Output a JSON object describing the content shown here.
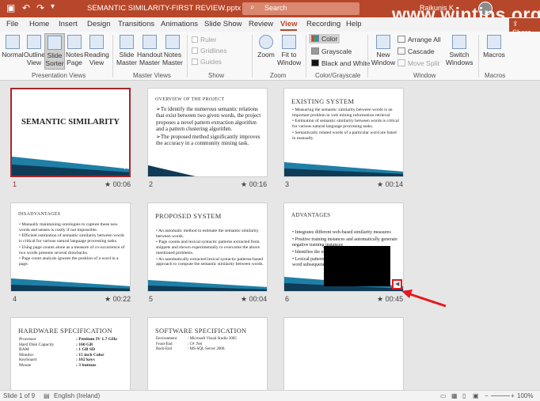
{
  "titlebar": {
    "title": "SEMANTIC SIMILARITY-FIRST REVIEW.pptx - PowerPoint",
    "search_placeholder": "Search",
    "user": "Raikunis K",
    "save_icon": "save-icon",
    "undo_icon": "undo-icon",
    "redo_icon": "redo-icon",
    "watermark": "www.wintips.org"
  },
  "tabs": [
    "File",
    "Home",
    "Insert",
    "Design",
    "Transitions",
    "Animations",
    "Slide Show",
    "Review",
    "View",
    "Recording",
    "Help"
  ],
  "active_tab": "View",
  "share_label": "Share",
  "ribbon": {
    "presentation_views": {
      "label": "Presentation Views",
      "buttons": [
        "Normal",
        "Outline View",
        "Slide Sorter",
        "Notes Page",
        "Reading View"
      ]
    },
    "master_views": {
      "label": "Master Views",
      "buttons": [
        "Slide Master",
        "Handout Master",
        "Notes Master"
      ]
    },
    "show": {
      "label": "Show",
      "items": [
        "Ruler",
        "Gridlines",
        "Guides"
      ]
    },
    "zoom": {
      "label": "Zoom",
      "buttons": [
        "Zoom",
        "Fit to Window"
      ]
    },
    "color": {
      "label": "Color/Grayscale",
      "items": [
        "Color",
        "Grayscale",
        "Black and White"
      ]
    },
    "window": {
      "label": "Window",
      "buttons": [
        "New Window"
      ],
      "items": [
        "Arrange All",
        "Cascade",
        "Move Split"
      ],
      "switch": "Switch Windows"
    },
    "macros": {
      "label": "Macros",
      "buttons": [
        "Macros"
      ]
    }
  },
  "slides": [
    {
      "num": "1",
      "time": "00:06",
      "title": "SEMANTIC SIMILARITY",
      "body": []
    },
    {
      "num": "2",
      "time": "00:16",
      "title": "OVERVIEW OF THE PROJECT",
      "body": [
        "➢To identify the numerous semantic relations that exist between two given words, the project proposes a novel pattern extraction algorithm and a pattern clustering algorithm.",
        "➢The proposed method significantly improves the accuracy in a community mining task."
      ]
    },
    {
      "num": "3",
      "time": "00:14",
      "title": "EXISTING SYSTEM",
      "body": [
        "• Measuring the semantic similarity between words is an important problem in web mining information retrieval",
        "• Estimation of semantic similarity between words is critical for various natural language processing tasks.",
        "• Semantically related words of a particular word are listed in manually"
      ]
    },
    {
      "num": "4",
      "time": "00:22",
      "title": "DISADVANTAGES",
      "body": [
        "• Manually maintaining ontologies to capture these new words and senses is costly if not impossible.",
        "• Efficient estimation of semantic similarity between words is critical for various natural language processing tasks.",
        "• Using page counts alone as a measure of co-occurrence of two words presents several drawbacks.",
        "• Page count analysis ignores the position of a word in a page."
      ]
    },
    {
      "num": "5",
      "time": "00:04",
      "title": "PROPOSED SYSTEM",
      "body": [
        "• An automatic method to estimate the semantic similarity between words.",
        "• Page counts and lexical syntactic patterns extracted from snippets and shown experimentally to overcome the above mentioned problems.",
        "• An automatically extracted lexical syntactic patterns-based approach to compute the semantic similarity between words."
      ]
    },
    {
      "num": "6",
      "time": "00:45",
      "title": "ADVANTAGES",
      "body": [
        "• Integrates different web-based similarity measures",
        "• Positive training instances and automatically generate negative training instances",
        "• Identifies the numerous semantic relations",
        "• Lexical patterns in a community mining considers word subsequences"
      ]
    },
    {
      "num": "7",
      "time": "",
      "title": "HARDWARE SPECIFICATION",
      "specs": [
        [
          "Processor",
          ": Pentium IV 1.7 GHz"
        ],
        [
          "Hard Disk Capacity",
          ": 160 GB"
        ],
        [
          "RAM",
          ": 1 GB SD"
        ],
        [
          "Monitor",
          ": 15 inch Color"
        ],
        [
          "Keyboard",
          ": 102 keys"
        ],
        [
          "Mouse",
          ": 3 buttons"
        ]
      ]
    },
    {
      "num": "8",
      "time": "",
      "title": "SOFTWARE SPECIFICATION",
      "specs": [
        [
          "Environment",
          ": Microsoft Visual Studio 2005"
        ],
        [
          "Front-End",
          ": C# .Net"
        ],
        [
          "Back-End",
          ": MS-SQL Server 2000."
        ]
      ]
    },
    {
      "num": "9",
      "time": "",
      "title": "",
      "body": []
    }
  ],
  "status": {
    "slide": "Slide 1 of 9",
    "language": "English (Ireland)",
    "zoom": "100%"
  },
  "colors": {
    "accent": "#b7472a",
    "slide_blue": "#1f7fa6",
    "selected_border": "#a4262c",
    "annotation_red": "#e5191f"
  }
}
